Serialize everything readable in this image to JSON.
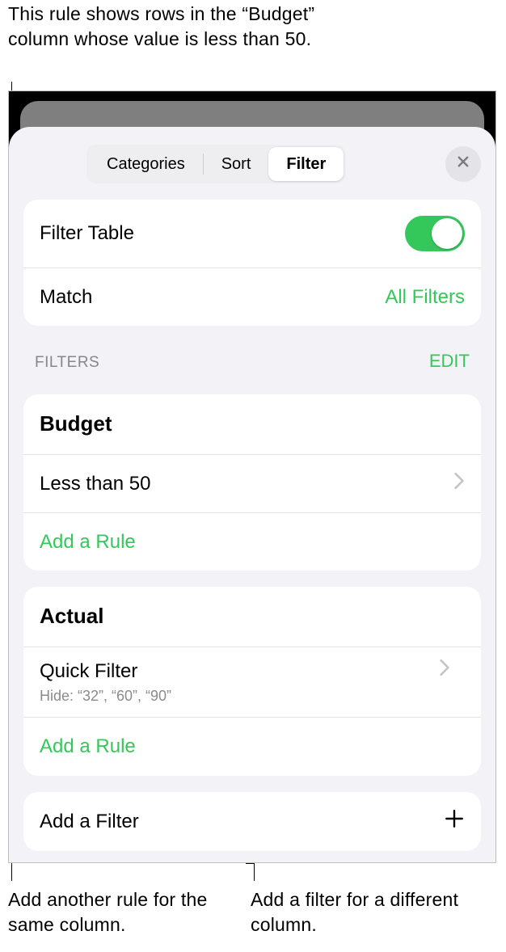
{
  "callouts": {
    "top": "This rule shows rows in the “Budget” column whose value is less than 50.",
    "bottom_left": "Add another rule for the same column.",
    "bottom_right": "Add a filter for a different column."
  },
  "segmented": {
    "categories": "Categories",
    "sort": "Sort",
    "filter": "Filter"
  },
  "top_card": {
    "filter_table_label": "Filter Table",
    "match_label": "Match",
    "match_value": "All Filters"
  },
  "section": {
    "title": "FILTERS",
    "edit": "EDIT"
  },
  "group1": {
    "title": "Budget",
    "rule": "Less than 50",
    "add_rule": "Add a Rule"
  },
  "group2": {
    "title": "Actual",
    "rule": "Quick Filter",
    "rule_sub": "Hide: “32”, “60”, “90”",
    "add_rule": "Add a Rule"
  },
  "add_filter": "Add a Filter",
  "colors": {
    "accent": "#34c759"
  }
}
